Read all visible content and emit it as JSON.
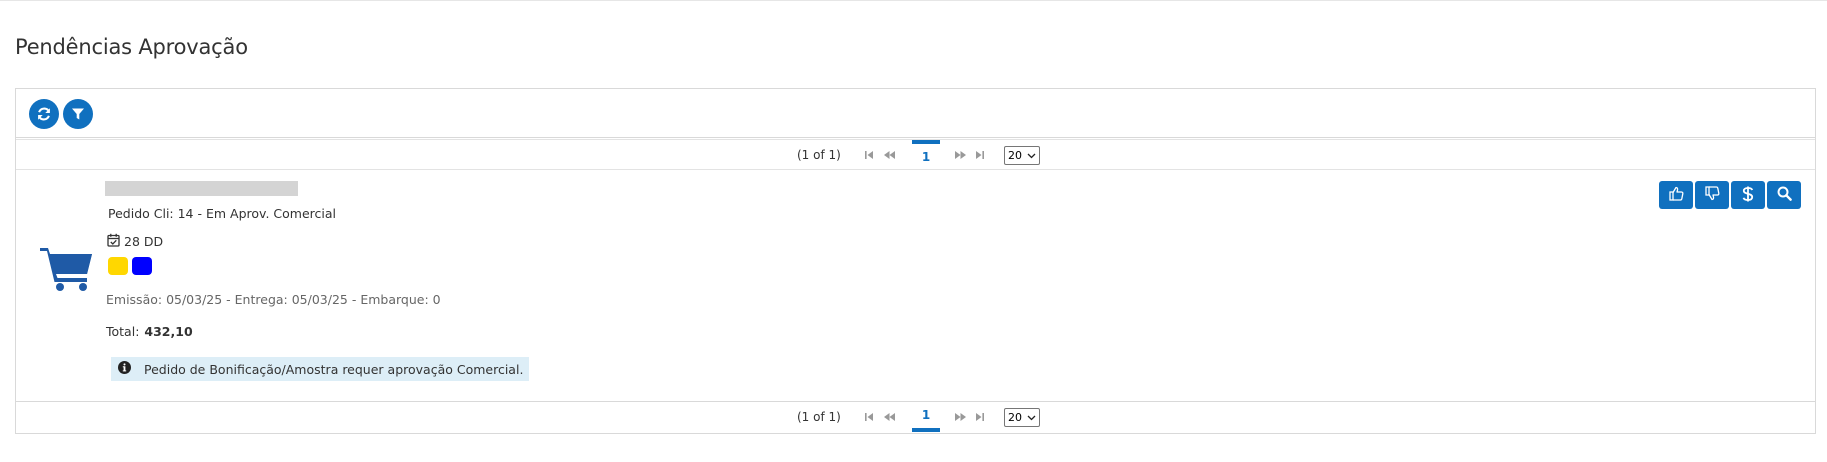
{
  "page": {
    "title": "Pendências Aprovação"
  },
  "toolbar": {
    "refresh_icon": "refresh-icon",
    "filter_icon": "filter-icon",
    "accent_color": "#1070bf"
  },
  "paginator": {
    "report": "(1 of 1)",
    "current_page": "1",
    "rows_per_page": "20",
    "icons": [
      "first-page-icon",
      "prev-page-icon",
      "next-page-icon",
      "last-page-icon"
    ]
  },
  "order": {
    "icon": "shopping-cart-icon",
    "pedido_cli": "Pedido Cli: 14 - Em Aprov. Comercial",
    "terms": "28 DD",
    "tag_colors": [
      "#ffd700",
      "#0000ff"
    ],
    "dates": "Emissão: 05/03/25 - Entrega: 05/03/25 - Embarque: 0",
    "total_label": "Total:",
    "total_value": "432,10",
    "info_message": "Pedido de Bonificação/Amostra requer aprovação Comercial.",
    "actions": [
      "thumbs-up-icon",
      "thumbs-down-icon",
      "dollar-icon",
      "search-icon"
    ]
  }
}
